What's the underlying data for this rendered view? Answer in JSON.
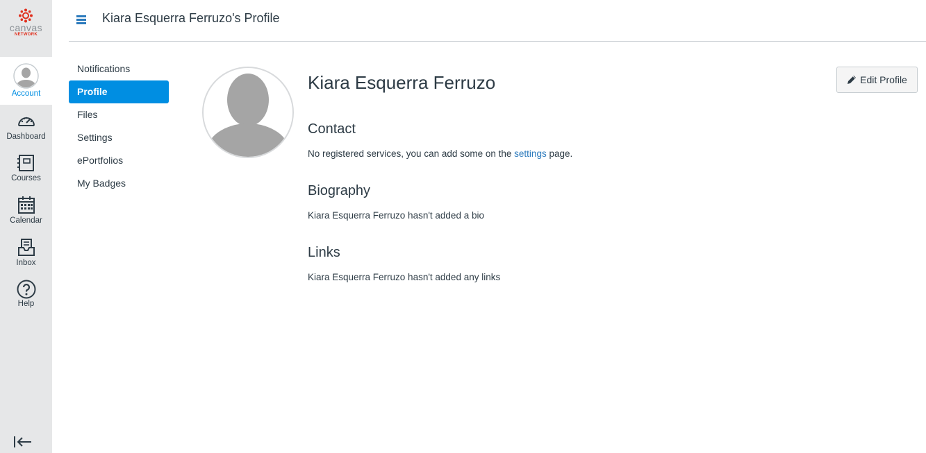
{
  "brand": {
    "wordmark": "canvas",
    "sub": "NETWORK",
    "color": "#e0301e"
  },
  "global_nav": {
    "account": "Account",
    "items": [
      {
        "id": "dashboard",
        "label": "Dashboard",
        "icon": "dashboard-icon"
      },
      {
        "id": "courses",
        "label": "Courses",
        "icon": "courses-icon"
      },
      {
        "id": "calendar",
        "label": "Calendar",
        "icon": "calendar-icon"
      },
      {
        "id": "inbox",
        "label": "Inbox",
        "icon": "inbox-icon"
      },
      {
        "id": "help",
        "label": "Help",
        "icon": "help-icon"
      }
    ]
  },
  "header": {
    "title": "Kiara Esquerra Ferruzo's Profile"
  },
  "subnav": {
    "items": [
      "Notifications",
      "Profile",
      "Files",
      "Settings",
      "ePortfolios",
      "My Badges"
    ],
    "active": "Profile"
  },
  "profile": {
    "name": "Kiara Esquerra Ferruzo",
    "edit_button": "Edit Profile",
    "contact": {
      "heading": "Contact",
      "text_before": "No registered services, you can add some on the ",
      "link": "settings",
      "text_after": " page."
    },
    "biography": {
      "heading": "Biography",
      "text": "Kiara Esquerra Ferruzo hasn't added a bio"
    },
    "links": {
      "heading": "Links",
      "text": "Kiara Esquerra Ferruzo hasn't added any links"
    }
  },
  "colors": {
    "accent": "#008ee2",
    "link": "#2b7abc",
    "nav_bg": "#e6e7e8"
  }
}
